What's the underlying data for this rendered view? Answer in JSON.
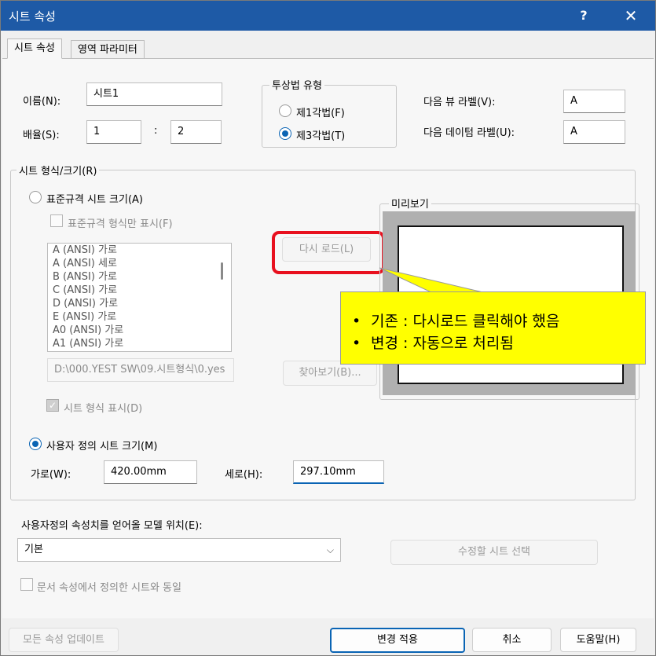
{
  "window": {
    "title": "시트 속성",
    "help": "?",
    "close": "✕"
  },
  "tabs": [
    {
      "label": "시트 속성",
      "active": true
    },
    {
      "label": "영역 파라미터",
      "active": false
    }
  ],
  "fields": {
    "name_label": "이름(N):",
    "name_value": "시트1",
    "scale_label": "배율(S):",
    "scale_a": "1",
    "scale_sep": ":",
    "scale_b": "2",
    "next_view_label": "다음 뷰 라벨(V):",
    "next_view_value": "A",
    "next_datum_label": "다음 데이텀 라벨(U):",
    "next_datum_value": "A"
  },
  "projection": {
    "title": "투상법 유형",
    "first": "제1각법(F)",
    "third": "제3각법(T)",
    "selected": "third"
  },
  "sheet_format": {
    "title": "시트 형식/크기(R)",
    "standard_radio": "표준규격 시트 크기(A)",
    "standard_only_check": "표준규격 형식만 표시(F)",
    "list_items": [
      "A (ANSI) 가로",
      "A (ANSI) 세로",
      "B (ANSI) 가로",
      "C (ANSI) 가로",
      "D (ANSI) 가로",
      "E (ANSI) 가로",
      "A0 (ANSI) 가로",
      "A1 (ANSI) 가로"
    ],
    "reload_button": "다시 로드(L)",
    "path": "D:\\000.YEST SW\\09.시트형식\\0.yes",
    "browse_button": "찾아보기(B)...",
    "display_format_check": "시트 형식 표시(D)",
    "custom_radio": "사용자 정의 시트 크기(M)",
    "width_label": "가로(W):",
    "width_value": "420.00mm",
    "height_label": "세로(H):",
    "height_value": "297.10mm",
    "preview_title": "미리보기"
  },
  "callout": {
    "lines": [
      "기존 : 다시로드 클릭해야 했음",
      "변경 : 자동으로 처리됨"
    ],
    "bullet": "•",
    "fill_color": "#ffff00",
    "highlight_color": "#e8101e"
  },
  "model_location": {
    "label": "사용자정의 속성치를 얻어올 모델 위치(E):",
    "combo_value": "기본",
    "modify_sheet_button": "수정할 시트 선택",
    "same_as_doc_check": "문서 속성에서 정의한 시트와 동일"
  },
  "footer": {
    "update_all": "모든 속성 업데이트",
    "apply": "변경 적용",
    "cancel": "취소",
    "help": "도움말(H)"
  },
  "colors": {
    "titlebar": "#1e5aa6",
    "accent": "#0a64b4"
  }
}
